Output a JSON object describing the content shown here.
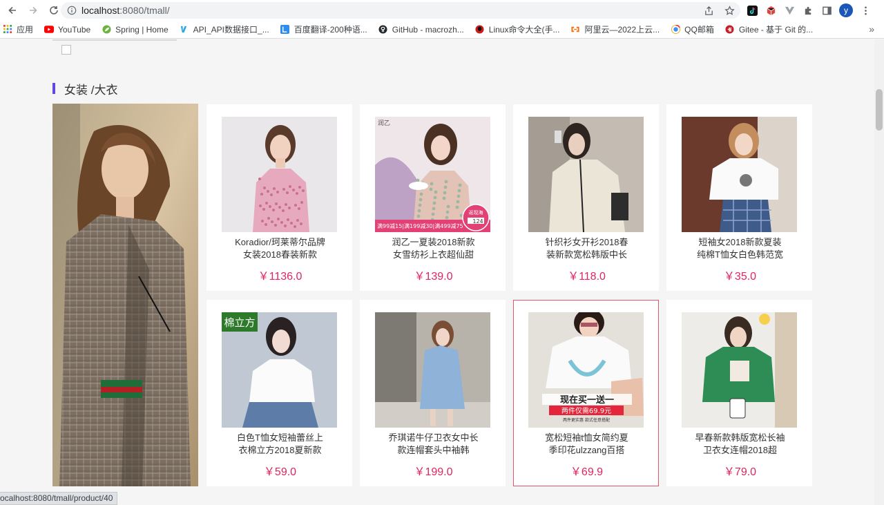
{
  "browser": {
    "url_host": "localhost",
    "url_rest": ":8080/tmall/",
    "profile_initial": "y",
    "bookmarks": [
      {
        "label": "应用",
        "icon": "apps-grid-icon"
      },
      {
        "label": "YouTube",
        "icon": "youtube-icon"
      },
      {
        "label": "Spring | Home",
        "icon": "spring-leaf-icon"
      },
      {
        "label": "API_API数据接口_...",
        "icon": "api-logo-icon"
      },
      {
        "label": "百度翻译-200种语...",
        "icon": "baidu-translate-icon"
      },
      {
        "label": "GitHub - macrozh...",
        "icon": "github-icon"
      },
      {
        "label": "Linux命令大全(手...",
        "icon": "linux-icon"
      },
      {
        "label": "阿里云—2022上云...",
        "icon": "aliyun-icon"
      },
      {
        "label": "QQ邮箱",
        "icon": "qq-mail-icon"
      },
      {
        "label": "Gitee - 基于 Git 的...",
        "icon": "gitee-icon"
      }
    ],
    "more_bookmarks": "»",
    "status_url": "ocalhost:8080/tmall/product/40"
  },
  "section": {
    "title": "女装 /大衣"
  },
  "products": [
    {
      "title": "Koradior/珂莱蒂尔品牌女装2018春装新款",
      "price": "￥1136.0"
    },
    {
      "title": "润乙一夏装2018新款女雪纺衫上衣超仙甜",
      "price": "￥139.0"
    },
    {
      "title": "针织衫女开衫2018春装新款宽松韩版中长",
      "price": "￥118.0"
    },
    {
      "title": "短袖女2018新款夏装纯棉T恤女白色韩范宽",
      "price": "￥35.0"
    },
    {
      "title": "白色T恤女短袖蕾丝上衣棉立方2018夏新款",
      "price": "￥59.0"
    },
    {
      "title": "乔琪诺牛仔卫衣女中长款连帽套头中袖韩",
      "price": "￥199.0"
    },
    {
      "title": "宽松短袖t恤女简约夏季印花ulzzang百搭",
      "price": "￥69.9"
    },
    {
      "title": "早春新款韩版宽松长袖卫衣女连帽2018超",
      "price": "￥79.0"
    }
  ],
  "image_texts": {
    "p2_corner": "润乙",
    "p2_badge": "返现海",
    "p2_badge_num": "124",
    "p2_strip": "满99减15|满199减30|满499减75",
    "p5_brand": "棉立方",
    "p7_line1": "现在买一送一",
    "p7_line2": "两件仅需69.9元",
    "p7_line3": "两件更实惠 款式任意搭配"
  },
  "colors": {
    "accent_bar": "#6347e0",
    "price": "#e0245e",
    "active_border": "#e8536b"
  }
}
